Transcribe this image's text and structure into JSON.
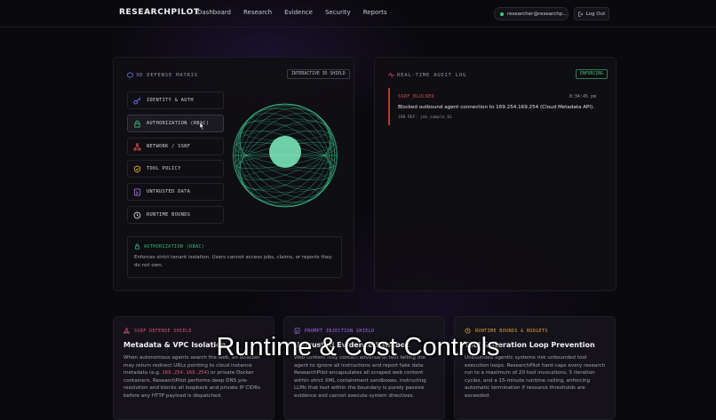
{
  "nav": {
    "brand": "RESEARCHPILOT",
    "links": [
      "Dashboard",
      "Research",
      "Evidence",
      "Security",
      "Reports"
    ],
    "user_email": "researcher@researchp...",
    "logout_label": "Log Out"
  },
  "matrix": {
    "title": "3D DEFENSE MATRIX",
    "tag": "INTERACTIVE 3D SHIELD",
    "layers": [
      {
        "label": "IDENTITY & AUTH",
        "icon": "key-icon",
        "color": "#6a7cff"
      },
      {
        "label": "AUTHORIZATION (RBAC)",
        "icon": "lock-icon",
        "color": "#35c07a"
      },
      {
        "label": "NETWORK / SSRF",
        "icon": "network-icon",
        "color": "#e04a4a"
      },
      {
        "label": "TOOL POLICY",
        "icon": "shield-icon",
        "color": "#e6a53a"
      },
      {
        "label": "UNTRUSTED DATA",
        "icon": "data-icon",
        "color": "#a46cf0"
      },
      {
        "label": "RUNTIME BOUNDS",
        "icon": "clock-icon",
        "color": "#d0d0d8"
      }
    ],
    "active_index": 1,
    "info_title": "AUTHORIZATION (RBAC)",
    "info_text": "Enforces strict tenant isolation. Users cannot access jobs, claims, or reports they do not own.",
    "sphere_color": "#3fd89a"
  },
  "audit": {
    "title": "REAL-TIME AUDIT LOG",
    "tag": "ENFORCING",
    "entries": [
      {
        "status": "SSRF_BLOCKED",
        "time": "8:34:45 pm",
        "message": "Blocked outbound agent connection to 169.254.169.254 (Cloud Metadata API).",
        "ref": "JOB REF: job_sample_01"
      }
    ]
  },
  "features": [
    {
      "label": "SSRF DEFENSE SHIELD",
      "label_color": "#e0577a",
      "icon": "network-icon",
      "heading": "Metadata & VPC Isolation",
      "body_pre": "When autonomous agents search the web, an attacker may return redirect URLs pointing to cloud instance metadata (e.g. ",
      "body_code": "169.254.169.254",
      "body_post": ") or private Docker containers. ResearchPilot performs deep DNS pre-resolution and blocks all loopback and private IP CIDRs before any HTTP payload is dispatched."
    },
    {
      "label": "PROMPT INJECTION SHIELD",
      "label_color": "#a46cf0",
      "icon": "data-icon",
      "heading": "Untrusted Evidence Sandbox",
      "body": "Web content may contain adversarial text telling the agent to ignore all instructions and report fake data. ResearchPilot encapsulates all scraped web content within strict XML containment sandboxes, instructing LLMs that text within the boundary is purely passive evidence and cannot execute system directives."
    },
    {
      "label": "RUNTIME BOUNDS & BUDGETS",
      "label_color": "#e6a53a",
      "icon": "clock-icon",
      "heading": "Tool & Iteration Loop Prevention",
      "body": "Unbounded agentic systems risk unbounded tool execution loops. ResearchPilot hard-caps every research run to a maximum of 20 tool invocations, 5 iteration cycles, and a 15-minute runtime ceiling, enforcing automatic termination if resource thresholds are exceeded."
    }
  ],
  "caption": "Runtime & Cost Controls"
}
